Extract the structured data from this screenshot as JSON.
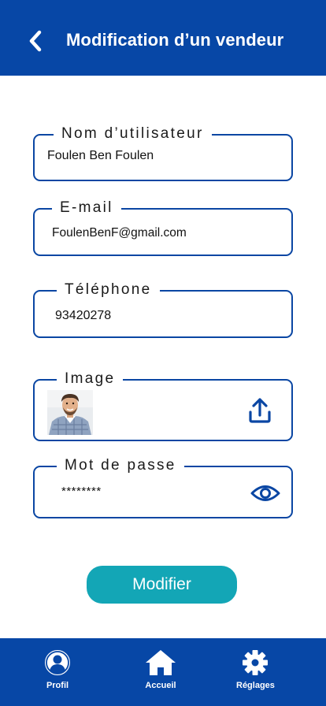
{
  "header": {
    "title": "Modification d’un vendeur",
    "back_icon": "chevron-left-icon"
  },
  "form": {
    "username": {
      "label": "Nom d’utilisateur",
      "value": "Foulen Ben Foulen"
    },
    "email": {
      "label": "E-mail",
      "value": "FoulenBenF@gmail.com"
    },
    "phone": {
      "label": "Téléphone",
      "value": "93420278"
    },
    "image": {
      "label": "Image",
      "upload_icon": "upload-icon"
    },
    "password": {
      "label": "Mot de passe",
      "value": "********",
      "toggle_icon": "eye-icon"
    },
    "submit_label": "Modifier"
  },
  "tabbar": {
    "items": [
      {
        "label": "Profil",
        "icon": "user-circle-icon"
      },
      {
        "label": "Accueil",
        "icon": "home-icon"
      },
      {
        "label": "Réglages",
        "icon": "gear-icon"
      }
    ]
  },
  "colors": {
    "primary": "#0747a6",
    "accent": "#13a6b6",
    "border": "#0a46a3"
  }
}
